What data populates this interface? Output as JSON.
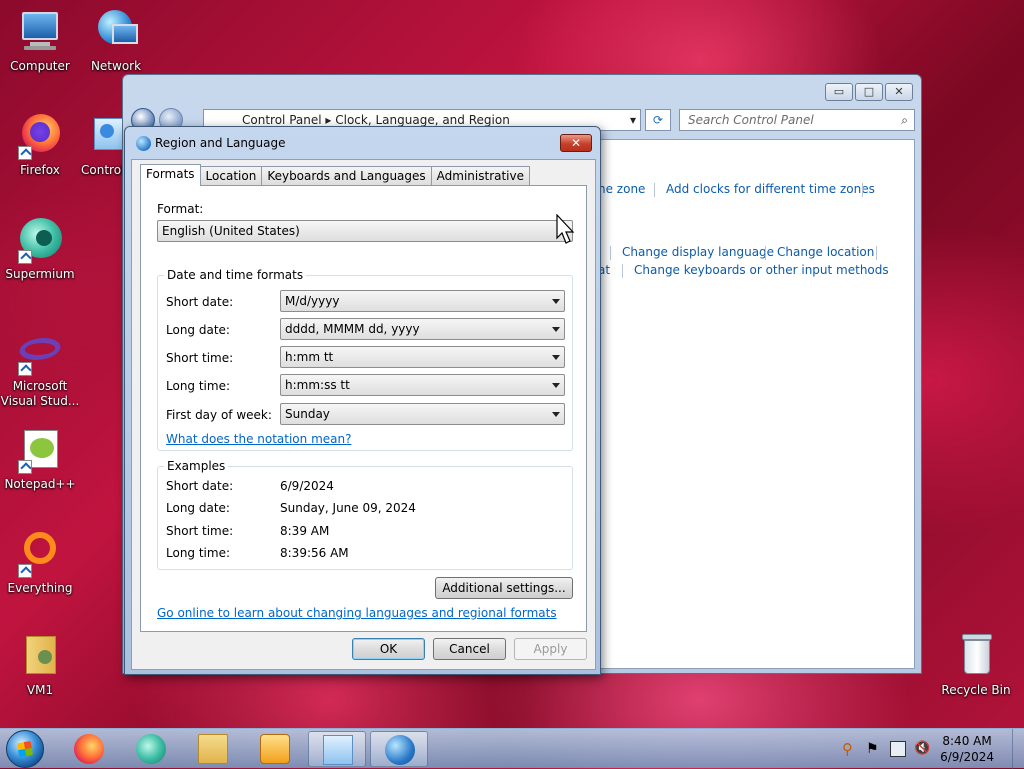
{
  "desktop": {
    "icons": [
      {
        "label": "Computer"
      },
      {
        "label": "Network"
      },
      {
        "label": "Firefox"
      },
      {
        "label": "Control"
      },
      {
        "label": "Supermium"
      },
      {
        "label": "Microsoft Visual Stud..."
      },
      {
        "label": "Notepad++"
      },
      {
        "label": "Everything"
      },
      {
        "label": "VM1"
      },
      {
        "label": "Recycle Bin"
      }
    ]
  },
  "control_panel": {
    "breadcrumb": [
      "Control Panel",
      "Clock, Language, and Region"
    ],
    "search_placeholder": "Search Control Panel",
    "links": {
      "time_zone": "ne zone",
      "add_clocks": "Add clocks for different time zones",
      "change_display_language": "Change display language",
      "change_location": "Change location",
      "format_fragment": "at",
      "change_keyboards": "Change keyboards or other input methods"
    },
    "caption_buttons": {
      "minimize": "▭",
      "maximize": "□",
      "close": "✕"
    }
  },
  "dialog": {
    "title": "Region and Language",
    "close_glyph": "✕",
    "tabs": [
      {
        "label": "Formats",
        "active": true
      },
      {
        "label": "Location",
        "active": false
      },
      {
        "label": "Keyboards and Languages",
        "active": false
      },
      {
        "label": "Administrative",
        "active": false
      }
    ],
    "format_label": "Format:",
    "format_value": "English (United States)",
    "date_time_group": "Date and time formats",
    "fields": [
      {
        "label": "Short date:",
        "value": "M/d/yyyy"
      },
      {
        "label": "Long date:",
        "value": "dddd, MMMM dd, yyyy"
      },
      {
        "label": "Short time:",
        "value": "h:mm tt"
      },
      {
        "label": "Long time:",
        "value": "h:mm:ss tt"
      },
      {
        "label": "First day of week:",
        "value": "Sunday"
      }
    ],
    "notation_link": "What does the notation mean?",
    "examples_group": "Examples",
    "examples": [
      {
        "label": "Short date:",
        "value": "6/9/2024"
      },
      {
        "label": "Long date:",
        "value": "Sunday, June 09, 2024"
      },
      {
        "label": "Short time:",
        "value": "8:39 AM"
      },
      {
        "label": "Long time:",
        "value": "8:39:56 AM"
      }
    ],
    "additional_settings": "Additional settings...",
    "online_link": "Go online to learn about changing languages and regional formats",
    "buttons": {
      "ok": "OK",
      "cancel": "Cancel",
      "apply": "Apply"
    }
  },
  "taskbar": {
    "clock_time": "8:40 AM",
    "clock_date": "6/9/2024"
  },
  "colors": {
    "link": "#0066cc",
    "cp_link": "#0d5ba8",
    "accent": "#3c7fb1"
  }
}
